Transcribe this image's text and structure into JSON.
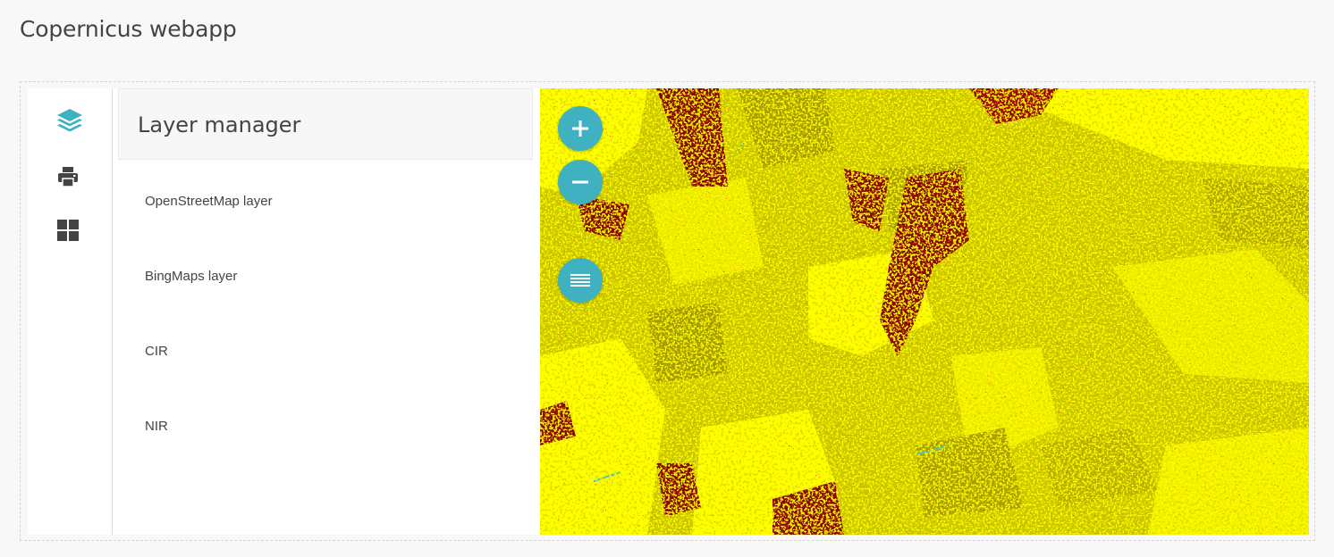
{
  "app": {
    "title": "Copernicus webapp"
  },
  "toolbar": {
    "tools": [
      {
        "name": "layers",
        "icon": "layers-icon"
      },
      {
        "name": "print",
        "icon": "print-icon"
      },
      {
        "name": "widgets",
        "icon": "grid-icon"
      }
    ],
    "active_color": "#3fb1c0",
    "icon_color": "#444444"
  },
  "panel": {
    "title": "Layer manager",
    "layers": [
      {
        "label": "OpenStreetMap layer"
      },
      {
        "label": "BingMaps layer"
      },
      {
        "label": "CIR"
      },
      {
        "label": "NIR"
      }
    ]
  },
  "map": {
    "controls": [
      {
        "name": "zoom-in",
        "icon": "plus-icon"
      },
      {
        "name": "zoom-out",
        "icon": "minus-icon"
      },
      {
        "name": "layer-switcher",
        "icon": "list-icon"
      }
    ],
    "control_color": "#3fb1c0",
    "palette": {
      "bright": "#ffff00",
      "olive": "#c4bd00",
      "dark_olive": "#9e9300",
      "red": "#8b0000",
      "water": "#3fc8c8"
    }
  }
}
